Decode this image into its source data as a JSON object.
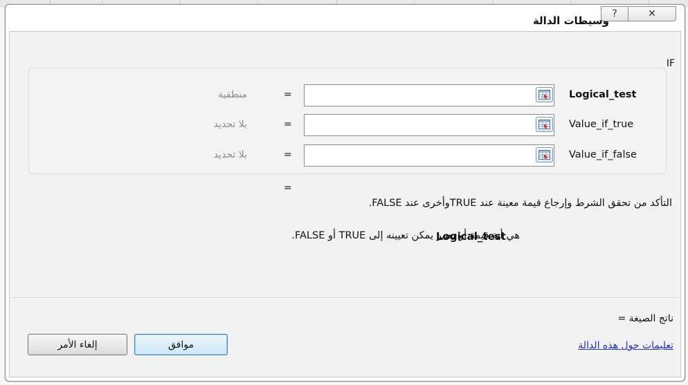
{
  "dialog": {
    "title": "وسيطات الدالة",
    "help_glyph": "?",
    "close_glyph": "✕"
  },
  "function_name": "IF",
  "args": [
    {
      "label": "Logical_test",
      "bold": true,
      "value": "",
      "result": "منطقية"
    },
    {
      "label": "Value_if_true",
      "bold": false,
      "value": "",
      "result": "بلا تحديد"
    },
    {
      "label": "Value_if_false",
      "bold": false,
      "value": "",
      "result": "بلا تحديد"
    }
  ],
  "equals_sign": "=",
  "description": "التأكد من تحقق الشرط وإرجاع قيمة معينة عند TRUEوأخرى عند FALSE.",
  "arg_description": {
    "name": "Logical_test",
    "text": "هي أية قيمة أو تعبير يمكن تعيينه إلى TRUE أو FALSE."
  },
  "formula_result_label": "ناتج الصيغة =",
  "help_link": "تعليمات حول هذه الدالة",
  "buttons": {
    "ok": "موافق",
    "cancel": "إلغاء الأمر"
  },
  "icons": {
    "ref_button": "range-select-icon",
    "help": "question-icon",
    "close": "close-icon"
  }
}
